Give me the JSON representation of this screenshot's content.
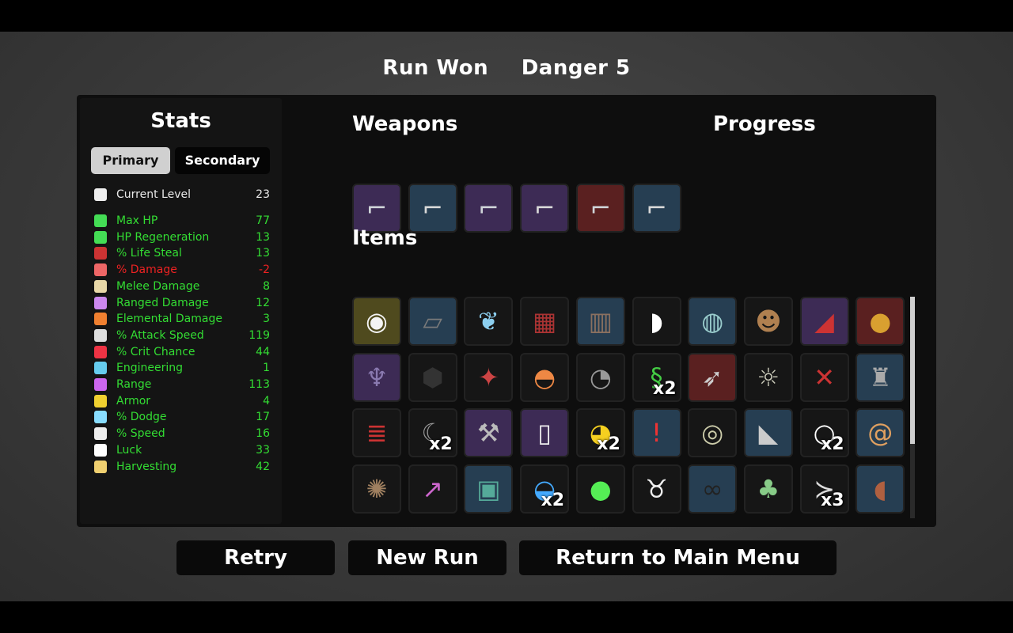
{
  "header": {
    "status": "Run Won",
    "danger": "Danger 5"
  },
  "stats": {
    "title": "Stats",
    "tab_primary": "Primary",
    "tab_secondary": "Secondary",
    "current_level": {
      "label": "Current Level",
      "value": "23",
      "icon": "skull-icon",
      "color": "#ffffff"
    },
    "rows": [
      {
        "label": "Max HP",
        "value": "77",
        "icon": "heart-icon",
        "color": "#33dd33"
      },
      {
        "label": "HP Regeneration",
        "value": "13",
        "icon": "heart-plus-icon",
        "color": "#33dd33"
      },
      {
        "label": "% Life Steal",
        "value": "13",
        "icon": "fangs-icon",
        "color": "#33dd33"
      },
      {
        "label": "% Damage",
        "value": "-2",
        "icon": "muscle-icon",
        "color": "#ee2222"
      },
      {
        "label": "Melee Damage",
        "value": "8",
        "icon": "sword-icon",
        "color": "#33dd33"
      },
      {
        "label": "Ranged Damage",
        "value": "12",
        "icon": "bow-icon",
        "color": "#33dd33"
      },
      {
        "label": "Elemental Damage",
        "value": "3",
        "icon": "flame-icon",
        "color": "#33dd33"
      },
      {
        "label": "% Attack Speed",
        "value": "119",
        "icon": "hourglass-icon",
        "color": "#33dd33"
      },
      {
        "label": "% Crit Chance",
        "value": "44",
        "icon": "crit-icon",
        "color": "#33dd33"
      },
      {
        "label": "Engineering",
        "value": "1",
        "icon": "wrench-icon",
        "color": "#33dd33"
      },
      {
        "label": "Range",
        "value": "113",
        "icon": "signal-icon",
        "color": "#33dd33"
      },
      {
        "label": "Armor",
        "value": "4",
        "icon": "shield-icon",
        "color": "#33dd33"
      },
      {
        "label": "% Dodge",
        "value": "17",
        "icon": "dodge-icon",
        "color": "#33dd33"
      },
      {
        "label": "% Speed",
        "value": "16",
        "icon": "boot-icon",
        "color": "#33dd33"
      },
      {
        "label": "Luck",
        "value": "33",
        "icon": "dice-icon",
        "color": "#33dd33"
      },
      {
        "label": "Harvesting",
        "value": "42",
        "icon": "wheat-icon",
        "color": "#33dd33"
      }
    ]
  },
  "weapons": {
    "title": "Weapons",
    "items": [
      {
        "icon": "laser-gun-icon",
        "tier": "purple"
      },
      {
        "icon": "revolver-icon",
        "tier": "blue"
      },
      {
        "icon": "laser-gun-icon",
        "tier": "purple"
      },
      {
        "icon": "revolver-icon",
        "tier": "purple"
      },
      {
        "icon": "laser-gun-icon",
        "tier": "red"
      },
      {
        "icon": "revolver-icon",
        "tier": "blue"
      }
    ]
  },
  "progress": {
    "title": "Progress"
  },
  "items": {
    "title": "Items",
    "list": [
      {
        "icon": "egg-creature-icon",
        "tier": "gold",
        "qty": ""
      },
      {
        "icon": "bandage-icon",
        "tier": "blue",
        "qty": ""
      },
      {
        "icon": "butterfly-icon",
        "tier": "normal",
        "qty": ""
      },
      {
        "icon": "plaid-shirt-icon",
        "tier": "normal",
        "qty": ""
      },
      {
        "icon": "leather-vest-icon",
        "tier": "blue",
        "qty": ""
      },
      {
        "icon": "fang-icon",
        "tier": "normal",
        "qty": ""
      },
      {
        "icon": "flashlight-icon",
        "tier": "blue",
        "qty": ""
      },
      {
        "icon": "monkey-icon",
        "tier": "normal",
        "qty": ""
      },
      {
        "icon": "bandana-icon",
        "tier": "purple",
        "qty": ""
      },
      {
        "icon": "potato-icon",
        "tier": "red",
        "qty": ""
      },
      {
        "icon": "demon-mask-icon",
        "tier": "purple",
        "qty": ""
      },
      {
        "icon": "rock-icon",
        "tier": "normal",
        "qty": ""
      },
      {
        "icon": "bat-wing-icon",
        "tier": "normal",
        "qty": ""
      },
      {
        "icon": "propeller-hat-icon",
        "tier": "normal",
        "qty": ""
      },
      {
        "icon": "ufo-icon",
        "tier": "normal",
        "qty": ""
      },
      {
        "icon": "snake-icon",
        "tier": "normal",
        "qty": "x2"
      },
      {
        "icon": "rockets-icon",
        "tier": "red",
        "qty": ""
      },
      {
        "icon": "lizard-icon",
        "tier": "normal",
        "qty": ""
      },
      {
        "icon": "barbed-wire-icon",
        "tier": "normal",
        "qty": ""
      },
      {
        "icon": "robot-claw-icon",
        "tier": "blue",
        "qty": ""
      },
      {
        "icon": "dynamite-icon",
        "tier": "normal",
        "qty": ""
      },
      {
        "icon": "scythe-icon",
        "tier": "normal",
        "qty": "x2"
      },
      {
        "icon": "tools-icon",
        "tier": "purple",
        "qty": ""
      },
      {
        "icon": "baby-bottle-icon",
        "tier": "purple",
        "qty": ""
      },
      {
        "icon": "duck-icon",
        "tier": "normal",
        "qty": "x2"
      },
      {
        "icon": "alert-rat-icon",
        "tier": "blue",
        "qty": ""
      },
      {
        "icon": "turret-icon",
        "tier": "normal",
        "qty": ""
      },
      {
        "icon": "blade-icon",
        "tier": "blue",
        "qty": ""
      },
      {
        "icon": "snowball-icon",
        "tier": "normal",
        "qty": "x2"
      },
      {
        "icon": "snail-icon",
        "tier": "blue",
        "qty": ""
      },
      {
        "icon": "hedgehog-icon",
        "tier": "normal",
        "qty": ""
      },
      {
        "icon": "syringe-icon",
        "tier": "normal",
        "qty": ""
      },
      {
        "icon": "machine-icon",
        "tier": "blue",
        "qty": ""
      },
      {
        "icon": "cap-icon",
        "tier": "normal",
        "qty": "x2"
      },
      {
        "icon": "slime-icon",
        "tier": "normal",
        "qty": ""
      },
      {
        "icon": "cow-skull-icon",
        "tier": "normal",
        "qty": ""
      },
      {
        "icon": "glasses-icon",
        "tier": "blue",
        "qty": ""
      },
      {
        "icon": "moss-sack-icon",
        "tier": "normal",
        "qty": ""
      },
      {
        "icon": "fish-skeleton-icon",
        "tier": "normal",
        "qty": "x3"
      },
      {
        "icon": "larva-icon",
        "tier": "blue",
        "qty": ""
      }
    ]
  },
  "buttons": {
    "retry": "Retry",
    "new_run": "New Run",
    "main_menu": "Return to Main Menu"
  }
}
